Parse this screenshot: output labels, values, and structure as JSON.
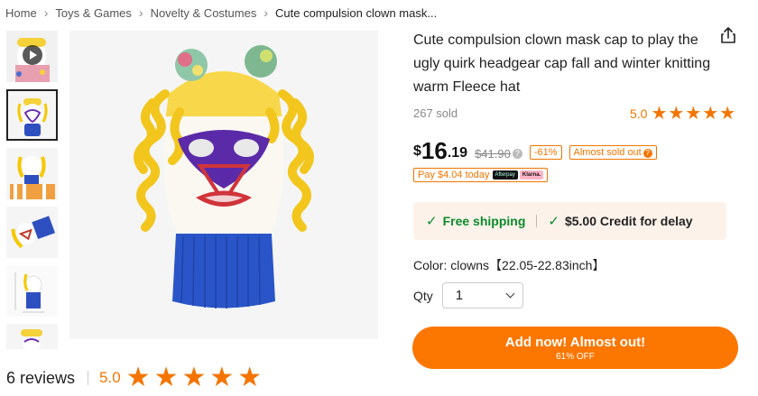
{
  "breadcrumb": {
    "items": [
      "Home",
      "Toys & Games",
      "Novelty & Costumes"
    ],
    "current": "Cute compulsion clown mask...",
    "separator": "›"
  },
  "gallery": {
    "thumbnail_count": 6,
    "selected_index": 1,
    "first_is_video": true
  },
  "product": {
    "title": "Cute compulsion clown mask cap to play the ugly quirk headgear cap fall and winter knitting warm Fleece hat",
    "sold": "267 sold",
    "rating": "5.0",
    "rating_stars": 5
  },
  "price": {
    "currency": "$",
    "integer": "16",
    "decimal": ".19",
    "original": "$41.90",
    "discount_badge": "-61%",
    "stock_badge": "Almost sold out",
    "pay_today": "Pay $4.04 today",
    "afterpay_label": "Afterpay",
    "klarna_label": "Klarna."
  },
  "shipping": {
    "free_label": "Free shipping",
    "credit_label": "$5.00 Credit for delay"
  },
  "variant": {
    "color_text": "Color: clowns【22.05-22.83inch】"
  },
  "quantity": {
    "label": "Qty",
    "value": "1"
  },
  "cta": {
    "main": "Add now! Almost out!",
    "sub": "61% OFF"
  },
  "reviews": {
    "count_text": "6 reviews",
    "score": "5.0",
    "stars": 5
  },
  "colors": {
    "accent": "#fb7701",
    "star": "#f37500",
    "green": "#0a8a2a",
    "shipping_bg": "#fdf2ea"
  },
  "icons": {
    "share": "share-icon",
    "star": "star-icon",
    "check": "check-icon",
    "chevron": "chevron-down-icon",
    "play": "play-icon",
    "question": "question-icon"
  }
}
